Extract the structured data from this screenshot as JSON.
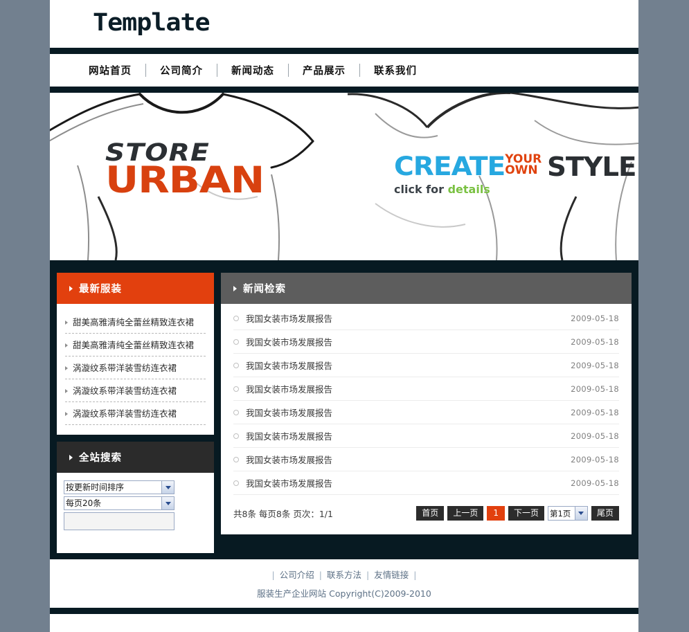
{
  "site": {
    "logo": "Template"
  },
  "nav": {
    "items": [
      {
        "label": "网站首页"
      },
      {
        "label": "公司简介"
      },
      {
        "label": "新闻动态"
      },
      {
        "label": "产品展示"
      },
      {
        "label": "联系我们"
      }
    ]
  },
  "banner": {
    "left": {
      "line1": "STORE",
      "line2": "URBAN"
    },
    "right": {
      "create": "CREATE",
      "your": "YOUR",
      "own": "OWN",
      "style": "STYLE",
      "click_for": "click for",
      "details": "details"
    },
    "colors": {
      "create": "#27a8e0",
      "your_own": "#e0430f",
      "style": "#2b2f33",
      "details": "#7ac142",
      "urban": "#d8410f"
    }
  },
  "sidebar": {
    "latest": {
      "title": "最新服装",
      "items": [
        {
          "label": "甜美高雅清纯全蕾丝精致连衣裙"
        },
        {
          "label": "甜美高雅清纯全蕾丝精致连衣裙"
        },
        {
          "label": "涡漩纹系带洋装雪纺连衣裙"
        },
        {
          "label": "涡漩纹系带洋装雪纺连衣裙"
        },
        {
          "label": "涡漩纹系带洋装雪纺连衣裙"
        }
      ]
    },
    "search": {
      "title": "全站搜索",
      "sort_select": {
        "value": "按更新时间排序",
        "options": [
          "按更新时间排序"
        ]
      },
      "perpage_select": {
        "value": "每页20条",
        "options": [
          "每页20条"
        ]
      },
      "keyword_input": {
        "value": "",
        "placeholder": ""
      }
    }
  },
  "news": {
    "title": "新闻检索",
    "rows": [
      {
        "title": "我国女装市场发展报告",
        "date": "2009-05-18"
      },
      {
        "title": "我国女装市场发展报告",
        "date": "2009-05-18"
      },
      {
        "title": "我国女装市场发展报告",
        "date": "2009-05-18"
      },
      {
        "title": "我国女装市场发展报告",
        "date": "2009-05-18"
      },
      {
        "title": "我国女装市场发展报告",
        "date": "2009-05-18"
      },
      {
        "title": "我国女装市场发展报告",
        "date": "2009-05-18"
      },
      {
        "title": "我国女装市场发展报告",
        "date": "2009-05-18"
      },
      {
        "title": "我国女装市场发展报告",
        "date": "2009-05-18"
      }
    ],
    "pager": {
      "summary": "共8条 每页8条 页次：1/1",
      "first": "首页",
      "prev": "上一页",
      "current": "1",
      "next": "下一页",
      "page_select": {
        "value": "第1页",
        "options": [
          "第1页"
        ]
      },
      "last": "尾页"
    }
  },
  "footer": {
    "links": [
      {
        "label": "公司介绍"
      },
      {
        "label": "联系方法"
      },
      {
        "label": "友情链接"
      }
    ],
    "copyright": "服装生产企业网站  Copyright(C)2009-2010"
  },
  "theme": {
    "page_bg": "#72808f",
    "dark": "#071a22",
    "orange": "#e2400e",
    "gray_head": "#5d5d5d",
    "dark_head": "#2b2b2b"
  }
}
